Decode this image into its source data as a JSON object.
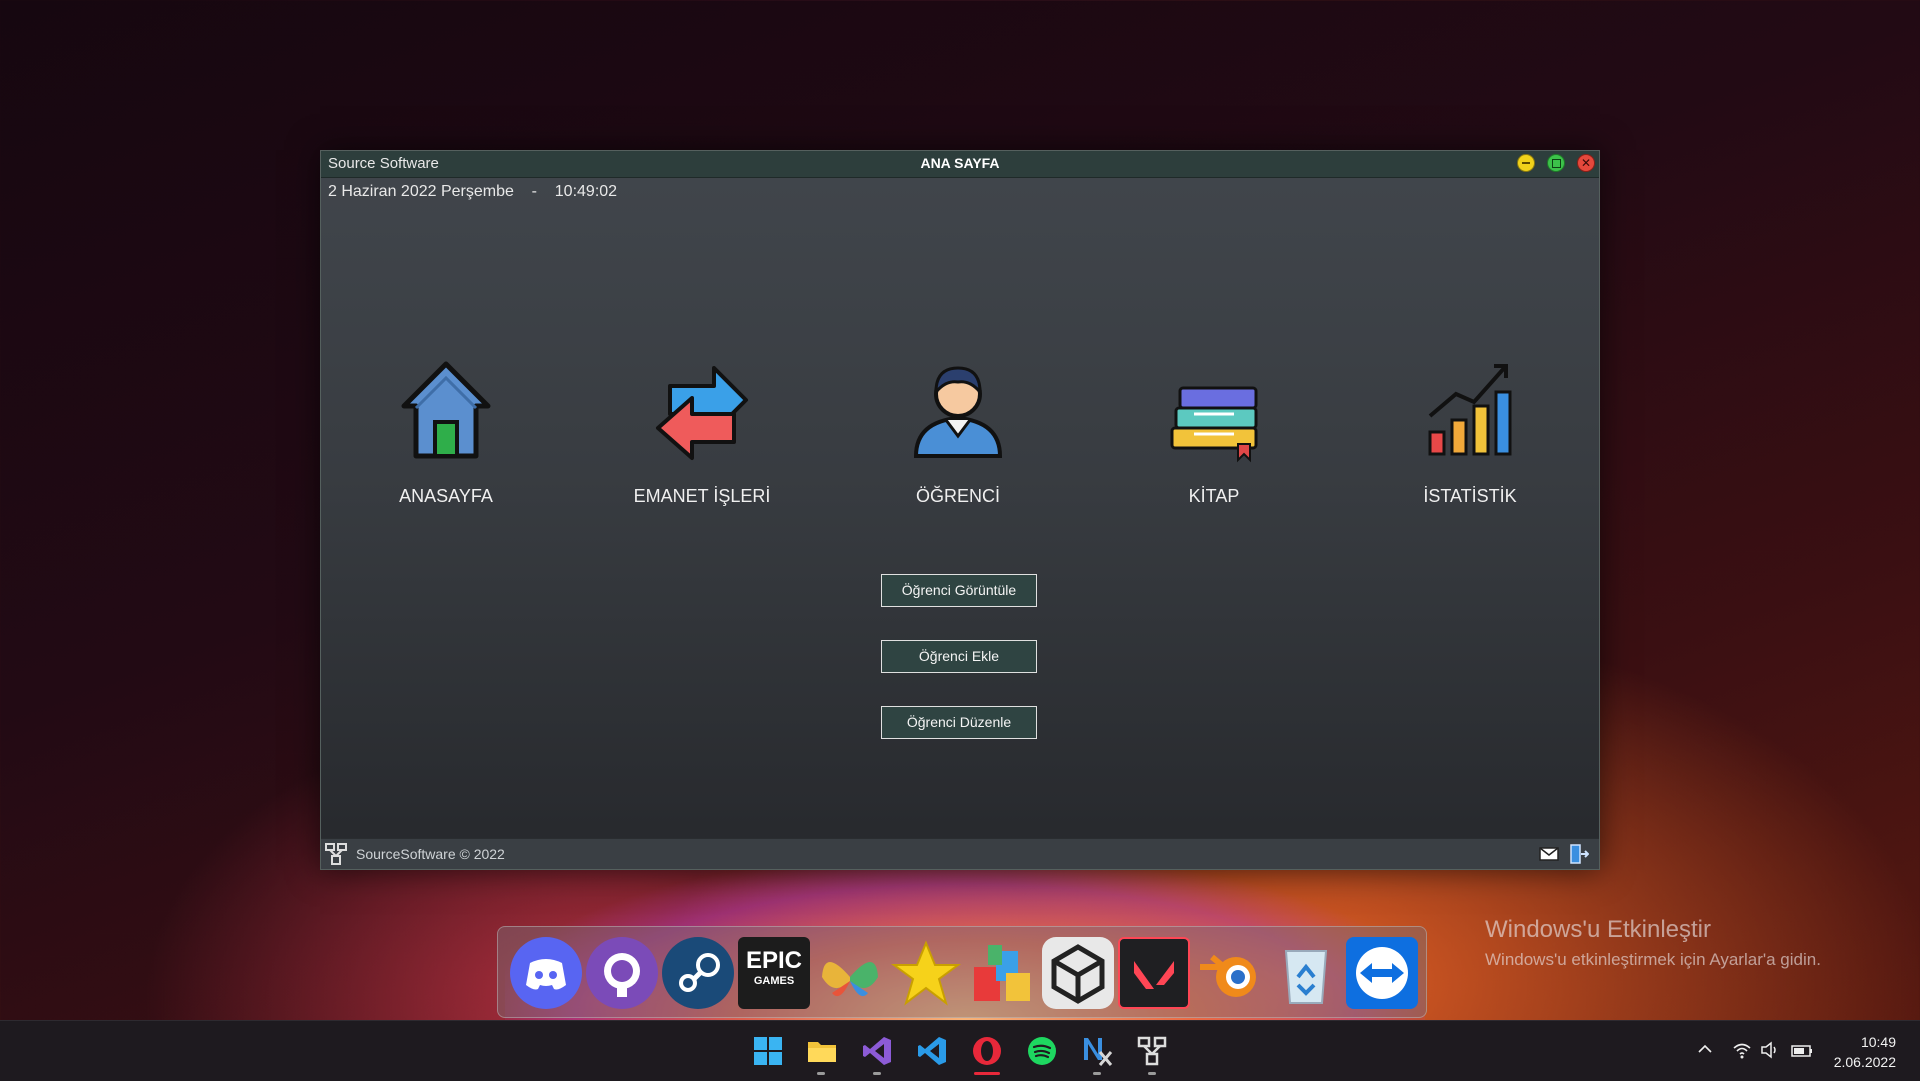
{
  "window": {
    "app_name": "Source Software",
    "page_title": "ANA SAYFA",
    "date": "2 Haziran 2022 Perşembe",
    "separator": "-",
    "time": "10:49:02",
    "close_glyph": "✕"
  },
  "nav": [
    {
      "label": "ANASAYFA",
      "icon": "house-icon"
    },
    {
      "label": "EMANET İŞLERİ",
      "icon": "exchange-arrows-icon"
    },
    {
      "label": "ÖĞRENCİ",
      "icon": "student-icon"
    },
    {
      "label": "KİTAP",
      "icon": "books-icon"
    },
    {
      "label": "İSTATİSTİK",
      "icon": "statistics-chart-icon"
    }
  ],
  "actions": {
    "view": "Öğrenci Görüntüle",
    "add": "Öğrenci Ekle",
    "edit": "Öğrenci Düzenle"
  },
  "footer": {
    "copyright": "SourceSoftware © 2022"
  },
  "watermark": {
    "title": "Windows'u Etkinleştir",
    "subtitle": "Windows'u etkinleştirmek için Ayarlar'a gidin."
  },
  "dock": [
    "discord-icon",
    "github-icon",
    "steam-icon",
    "epic-games-icon",
    "msn-butterfly-icon",
    "star-icon",
    "cube-app-icon",
    "unity-icon",
    "valorant-icon",
    "blender-icon",
    "recycle-bin-icon",
    "teamviewer-icon"
  ],
  "dock_epic_text": {
    "line1": "EPIC",
    "line2": "GAMES"
  },
  "taskbar": [
    "windows-start-icon",
    "file-explorer-icon",
    "visual-studio-icon",
    "vscode-icon",
    "opera-icon",
    "spotify-icon",
    "notepadx-icon",
    "sourcesoftware-icon"
  ],
  "clock": {
    "time": "10:49",
    "date": "2.06.2022"
  },
  "colors": {
    "titlebar": "#2d3e3c",
    "button_bg": "#2f4442",
    "minimize": "#f0d21a",
    "maximize": "#3cc24a",
    "close": "#e5483c"
  }
}
